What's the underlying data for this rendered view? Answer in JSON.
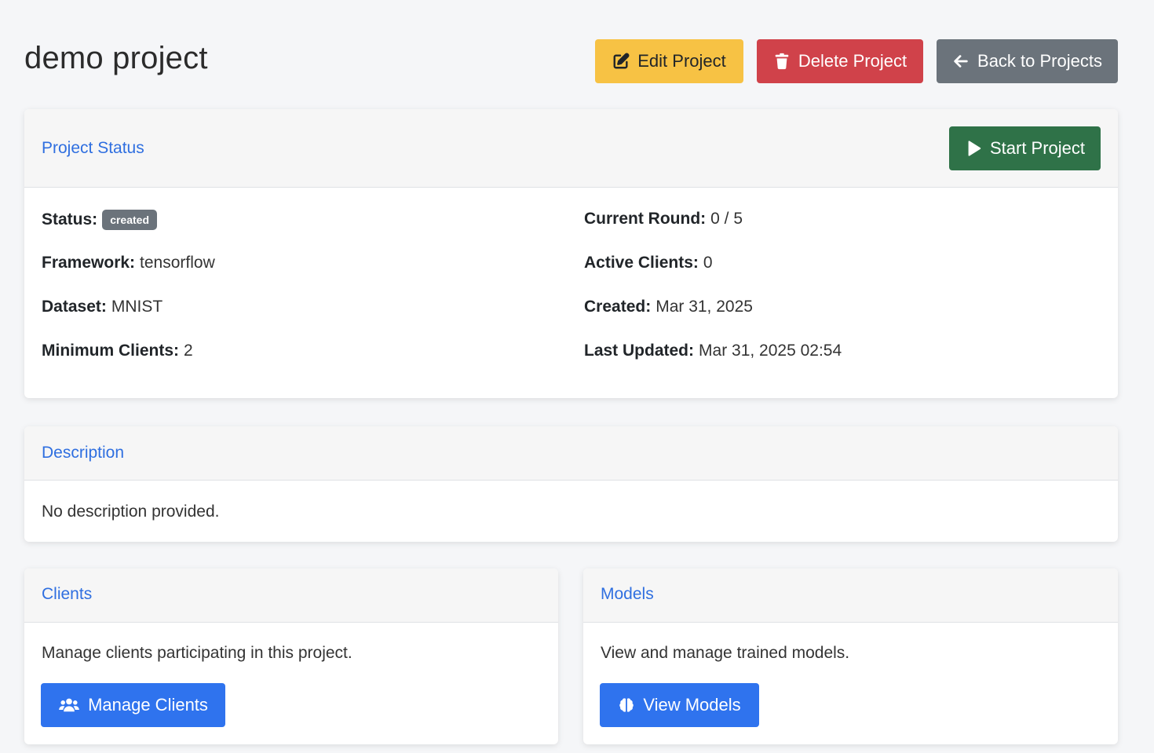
{
  "header": {
    "title": "demo project",
    "edit_label": "Edit Project",
    "delete_label": "Delete Project",
    "back_label": "Back to Projects"
  },
  "status_card": {
    "title": "Project Status",
    "start_label": "Start Project",
    "left": [
      {
        "label": "Status:",
        "badge": "created"
      },
      {
        "label": "Framework:",
        "value": "tensorflow"
      },
      {
        "label": "Dataset:",
        "value": "MNIST"
      },
      {
        "label": "Minimum Clients:",
        "value": "2"
      }
    ],
    "right": [
      {
        "label": "Current Round:",
        "value": "0 / 5"
      },
      {
        "label": "Active Clients:",
        "value": "0"
      },
      {
        "label": "Created:",
        "value": "Mar 31, 2025"
      },
      {
        "label": "Last Updated:",
        "value": "Mar 31, 2025 02:54"
      }
    ]
  },
  "description_card": {
    "title": "Description",
    "text": "No description provided."
  },
  "clients_card": {
    "title": "Clients",
    "text": "Manage clients participating in this project.",
    "button_label": "Manage Clients"
  },
  "models_card": {
    "title": "Models",
    "text": "View and manage trained models.",
    "button_label": "View Models"
  },
  "icons": {
    "edit": "edit-icon",
    "delete": "trash-icon",
    "back": "arrow-left-icon",
    "start": "play-icon",
    "clients": "users-icon",
    "models": "brain-icon"
  },
  "colors": {
    "edit": "#f7c244",
    "delete": "#d0424a",
    "back": "#6b737b",
    "start": "#2f7248",
    "primary": "#2f73ee",
    "link": "#2f6fe0",
    "badge": "#6b737b"
  }
}
